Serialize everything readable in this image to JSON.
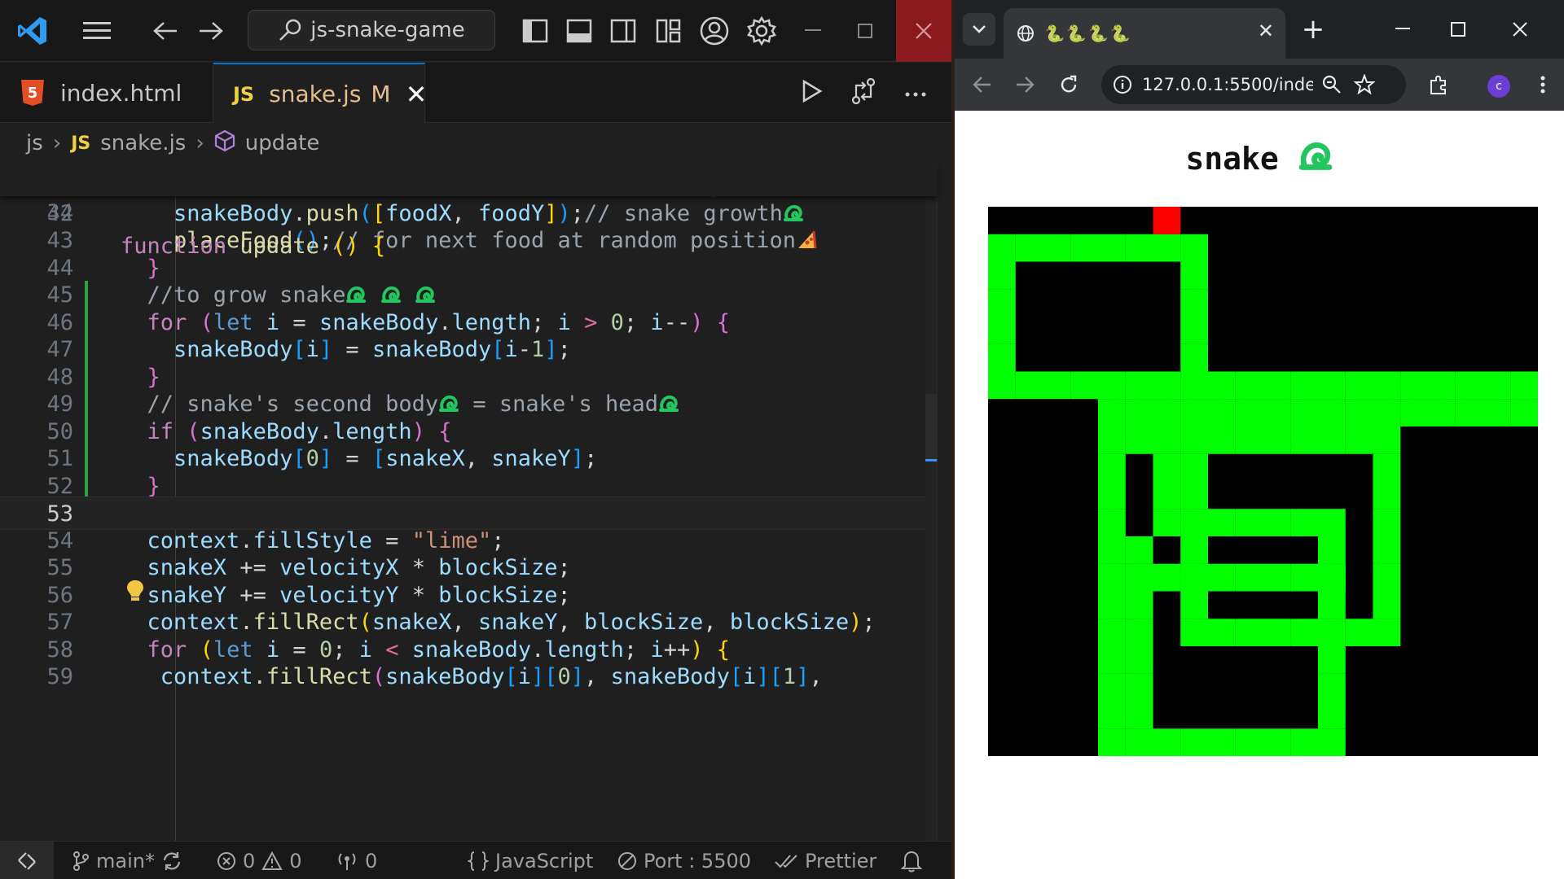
{
  "vscode": {
    "search": "js-snake-game",
    "tabs": [
      {
        "label": "index.html",
        "badge": "5"
      },
      {
        "label": "snake.js",
        "badge": "JS",
        "modified": "M"
      }
    ],
    "breadcrumb": {
      "folder": "js",
      "badge": "JS",
      "file": "snake.js",
      "symbol": "update"
    },
    "sticky": {
      "num": "34"
    },
    "line_numbers": [
      "41",
      "42",
      "43",
      "44",
      "45",
      "46",
      "47",
      "48",
      "49",
      "50",
      "51",
      "52",
      "53",
      "54",
      "55",
      "56",
      "57",
      "58",
      "59"
    ],
    "status": {
      "branch": "main*",
      "errors": "0",
      "warnings": "0",
      "ports": "0",
      "language": "JavaScript",
      "port": "Port : 5500",
      "formatter": "Prettier"
    }
  },
  "browser": {
    "tab_title": "🐍🐍🐍🐍",
    "url": "127.0.0.1:5500/index...",
    "profile_initial": "c",
    "page_title": "snake"
  },
  "colors": {
    "snake": "#00ff00",
    "food": "#ff0000",
    "board": "#000000",
    "accent": "#0078d4"
  },
  "game": {
    "grid": 20,
    "food": [
      6,
      0
    ],
    "snake_cells": [
      [
        0,
        1
      ],
      [
        1,
        1
      ],
      [
        2,
        1
      ],
      [
        3,
        1
      ],
      [
        4,
        1
      ],
      [
        5,
        1
      ],
      [
        6,
        1
      ],
      [
        7,
        1
      ],
      [
        0,
        2
      ],
      [
        0,
        3
      ],
      [
        0,
        4
      ],
      [
        0,
        5
      ],
      [
        0,
        6
      ],
      [
        7,
        2
      ],
      [
        7,
        3
      ],
      [
        7,
        4
      ],
      [
        7,
        5
      ],
      [
        7,
        6
      ],
      [
        1,
        6
      ],
      [
        2,
        6
      ],
      [
        3,
        6
      ],
      [
        4,
        6
      ],
      [
        5,
        6
      ],
      [
        6,
        6
      ],
      [
        8,
        7
      ],
      [
        9,
        7
      ],
      [
        10,
        7
      ],
      [
        11,
        7
      ],
      [
        12,
        7
      ],
      [
        13,
        7
      ],
      [
        14,
        7
      ],
      [
        15,
        7
      ],
      [
        16,
        7
      ],
      [
        17,
        7
      ],
      [
        18,
        7
      ],
      [
        19,
        7
      ],
      [
        8,
        6
      ],
      [
        9,
        6
      ],
      [
        10,
        6
      ],
      [
        11,
        6
      ],
      [
        12,
        6
      ],
      [
        13,
        6
      ],
      [
        14,
        6
      ],
      [
        15,
        6
      ],
      [
        16,
        6
      ],
      [
        17,
        6
      ],
      [
        18,
        6
      ],
      [
        19,
        6
      ],
      [
        4,
        7
      ],
      [
        5,
        7
      ],
      [
        6,
        7
      ],
      [
        7,
        7
      ],
      [
        4,
        8
      ],
      [
        4,
        9
      ],
      [
        4,
        10
      ],
      [
        4,
        11
      ],
      [
        4,
        12
      ],
      [
        4,
        13
      ],
      [
        4,
        14
      ],
      [
        4,
        15
      ],
      [
        4,
        16
      ],
      [
        4,
        17
      ],
      [
        4,
        18
      ],
      [
        4,
        19
      ],
      [
        14,
        8
      ],
      [
        14,
        9
      ],
      [
        14,
        10
      ],
      [
        14,
        11
      ],
      [
        14,
        12
      ],
      [
        14,
        13
      ],
      [
        14,
        14
      ],
      [
        14,
        15
      ],
      [
        5,
        8
      ],
      [
        6,
        8
      ],
      [
        7,
        8
      ],
      [
        8,
        8
      ],
      [
        9,
        8
      ],
      [
        10,
        8
      ],
      [
        11,
        8
      ],
      [
        12,
        8
      ],
      [
        13,
        8
      ],
      [
        6,
        9
      ],
      [
        6,
        10
      ],
      [
        6,
        11
      ],
      [
        7,
        9
      ],
      [
        7,
        10
      ],
      [
        7,
        11
      ],
      [
        7,
        12
      ],
      [
        7,
        13
      ],
      [
        7,
        14
      ],
      [
        7,
        15
      ],
      [
        8,
        11
      ],
      [
        9,
        11
      ],
      [
        10,
        11
      ],
      [
        11,
        11
      ],
      [
        12,
        11
      ],
      [
        12,
        12
      ],
      [
        12,
        13
      ],
      [
        12,
        14
      ],
      [
        12,
        15
      ],
      [
        12,
        16
      ],
      [
        12,
        17
      ],
      [
        12,
        18
      ],
      [
        12,
        19
      ],
      [
        8,
        15
      ],
      [
        9,
        15
      ],
      [
        10,
        15
      ],
      [
        11,
        15
      ],
      [
        13,
        15
      ],
      [
        5,
        13
      ],
      [
        6,
        13
      ],
      [
        7,
        13
      ],
      [
        8,
        13
      ],
      [
        9,
        13
      ],
      [
        10,
        13
      ],
      [
        11,
        13
      ],
      [
        12,
        13
      ],
      [
        5,
        12
      ],
      [
        5,
        14
      ],
      [
        5,
        15
      ],
      [
        5,
        16
      ],
      [
        5,
        17
      ],
      [
        5,
        18
      ],
      [
        5,
        19
      ],
      [
        6,
        19
      ],
      [
        7,
        19
      ],
      [
        8,
        19
      ],
      [
        9,
        19
      ],
      [
        10,
        19
      ],
      [
        11,
        19
      ]
    ]
  }
}
